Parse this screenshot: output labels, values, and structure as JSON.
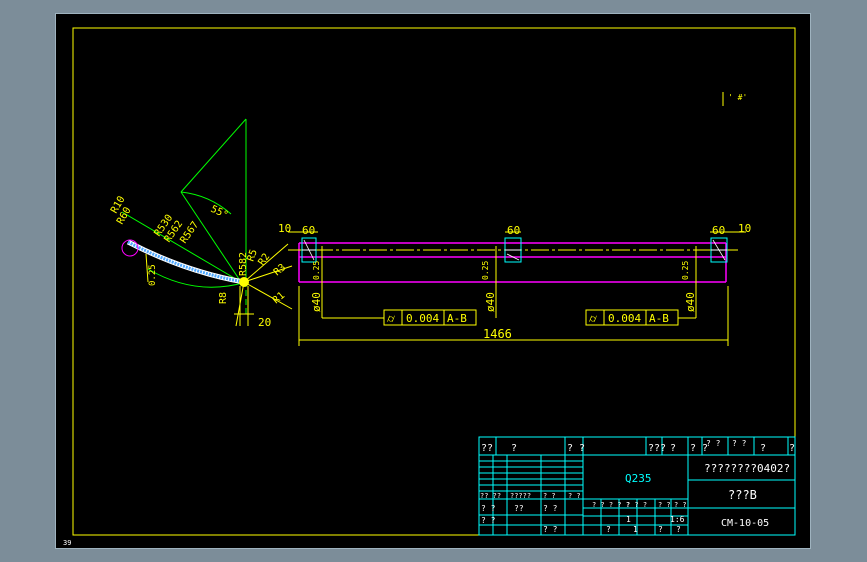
{
  "sheet": {
    "corner_label": "39",
    "note_mark": "' #'"
  },
  "left_view": {
    "angle": "55°",
    "radii": [
      "R10",
      "R60",
      "R530",
      "R562",
      "R567",
      "R582",
      "R5",
      "R2",
      "R3",
      "R1",
      "R8"
    ],
    "width_dim": "0.25",
    "bottom_dim": "20"
  },
  "front_view": {
    "dim_10_left": "10",
    "dim_60_left": "60",
    "dim_60_mid": "60",
    "dim_60_right": "60",
    "dim_10_right": "10",
    "diam_left": "ø40",
    "diam_mid": "ø40",
    "diam_right": "ø40",
    "tol_left": "0.25",
    "tol_mid": "0.25",
    "tol_right": "0.25",
    "overall_length": "1466",
    "geo_tol_left": {
      "symbol": "⌭",
      "value": "0.004",
      "datum": "A-B"
    },
    "geo_tol_right": {
      "symbol": "⌭",
      "value": "0.004",
      "datum": "A-B"
    }
  },
  "title_block": {
    "head_cells": [
      "??",
      "?",
      "? ?",
      "???",
      "?",
      "? ?",
      "? ?",
      "? ?",
      "?",
      "?"
    ],
    "material": "Q235",
    "title_main": "????????0402?",
    "title_sub": "???B",
    "drawing_no": "CM-10-05",
    "left_cells_r1": [
      "?? ??",
      "?????",
      "? ?",
      "? ?"
    ],
    "left_cells_r2": [
      "? ?",
      "??",
      "? ?"
    ],
    "left_cells_r3": [
      "? ?",
      "? ?"
    ],
    "mid_cells": [
      "? ? ? ? ?",
      "? ? ?",
      "? ?",
      "? ?"
    ],
    "scale_value": "1:6",
    "scale_mark": "1",
    "bottom_cells": [
      "?",
      "1",
      "?",
      "?"
    ]
  }
}
